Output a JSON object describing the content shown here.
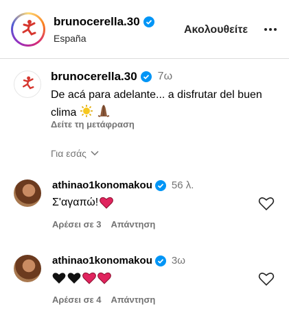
{
  "header": {
    "username": "brunocerella.30",
    "location": "España",
    "follow_label": "Ακολουθείτε"
  },
  "post": {
    "username": "brunocerella.30",
    "time": "7ω",
    "caption": "De acá para adelante... a disfrutar del buen clima",
    "caption_emojis": [
      "sun-icon",
      "praying-hands-icon"
    ],
    "translate_label": "Δείτε τη μετάφραση"
  },
  "for_you_label": "Για εσάς",
  "comments": [
    {
      "username": "athinao1konomakou",
      "time": "56 λ.",
      "text": "Σ'αγαπώ!",
      "emojis": [
        "red-heart"
      ],
      "likes_label": "Αρέσει σε 3",
      "reply_label": "Απάντηση"
    },
    {
      "username": "athinao1konomakou",
      "time": "3ω",
      "text": "",
      "emojis": [
        "black-heart",
        "black-heart",
        "red-heart",
        "red-heart"
      ],
      "likes_label": "Αρέσει σε 4",
      "reply_label": "Απάντηση"
    }
  ],
  "colors": {
    "verified": "#0095f6",
    "muted_text": "#737373",
    "heart_red": "#e0245e",
    "divider": "#dbdbdb"
  }
}
